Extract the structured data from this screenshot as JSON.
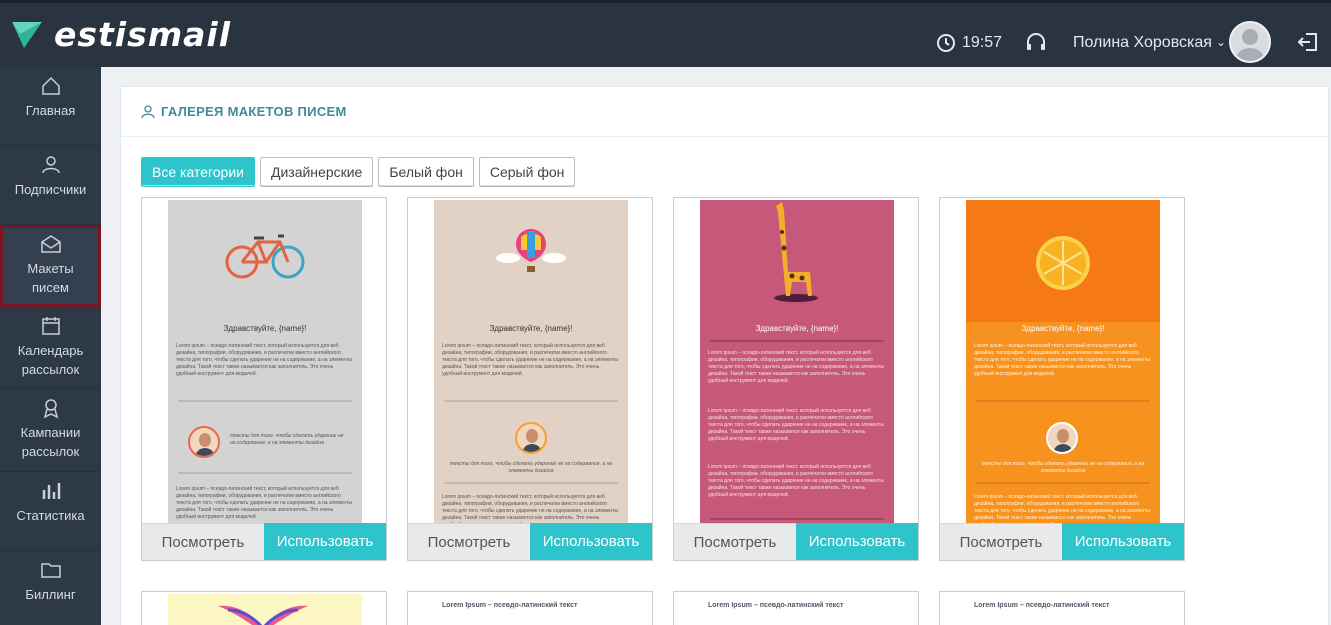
{
  "header": {
    "brand": "estismail",
    "time": "19:57",
    "user_name": "Полина Хоровская",
    "icons": [
      "clock-icon",
      "headset-icon",
      "avatar",
      "logout-icon"
    ]
  },
  "sidebar": {
    "items": [
      {
        "label": "Главная",
        "icon": "home-icon"
      },
      {
        "label": "Подписчики",
        "icon": "users-icon"
      },
      {
        "label": "Макеты писем",
        "icon": "envelope-icon",
        "active": true
      },
      {
        "label": "Календарь рассылок",
        "icon": "calendar-icon"
      },
      {
        "label": "Кампании рассылок",
        "icon": "campaign-icon"
      },
      {
        "label": "Статистика",
        "icon": "stats-icon"
      },
      {
        "label": "Биллинг",
        "icon": "folder-icon"
      }
    ]
  },
  "gallery": {
    "title": "ГАЛЕРЕЯ МАКЕТОВ ПИСЕМ",
    "filters": [
      "Все категории",
      "Дизайнерские",
      "Белый фон",
      "Серый фон"
    ],
    "active_filter": "Все категории"
  },
  "templates": {
    "view_label": "Посмотреть",
    "use_label": "Использовать",
    "greeting": "Здравствуйте, {name}!",
    "body_text": "Lorem ipsum – псевдо-латинский текст, который используется для веб дизайна, типографии, оборудования, и распечатки вместо английского текста для того, чтобы сделать ударение не на содержание, а на элементы дизайна. Такой текст также называется как заполнитель. Это очень удобный инструмент для моделей.",
    "quote_text": "тексты для того, чтобы сделать ударение не на содержание, а на элементы дизайна",
    "items": [
      {
        "name": "bicycle",
        "bg": "#d3d3d3"
      },
      {
        "name": "balloon",
        "bg": "#e2d2c6"
      },
      {
        "name": "giraffe",
        "bg": "#c6587a"
      },
      {
        "name": "orange",
        "bg": "#f7921e"
      }
    ],
    "second_row_header": "Lorem Ipsum – псевдо-латинский текст"
  },
  "colors": {
    "accent": "#2ec4cc",
    "topbar": "#293440",
    "sidebar": "#2d3947",
    "title": "#3d8c97"
  }
}
